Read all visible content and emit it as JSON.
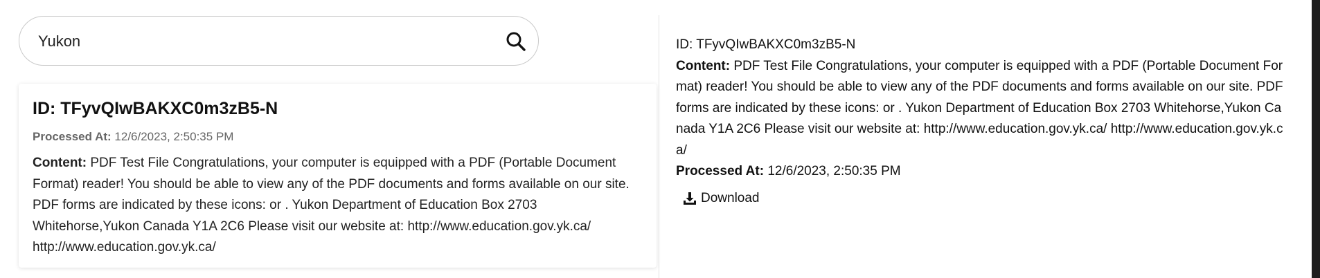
{
  "search": {
    "value": "Yukon"
  },
  "result": {
    "title": "ID: TFyvQIwBAKXC0m3zB5-N",
    "processed_label": "Processed At:",
    "processed_value": "12/6/2023, 2:50:35 PM",
    "content_label": "Content:",
    "content_text": "PDF Test File Congratulations, your computer is equipped with a PDF (Portable Document Format) reader! You should be able to view any of the PDF documents and forms available on our site. PDF forms are indicated by these icons: or . Yukon Department of Education Box 2703 Whitehorse,Yukon Canada Y1A 2C6 Please visit our website at: http://www.education.gov.yk.ca/ http://www.education.gov.yk.ca/"
  },
  "detail": {
    "id_line": "ID: TFyvQIwBAKXC0m3zB5-N",
    "content_label": "Content:",
    "content_text": "PDF Test File Congratulations, your computer is equipped with a PDF (Portable Document Format) reader! You should be able to view any of the PDF documents and forms available on our site. PDF forms are indicated by these icons: or . Yukon Department of Education Box 2703 Whitehorse,Yukon Canada Y1A 2C6 Please visit our website at: http://www.education.gov.yk.ca/ http://www.education.gov.yk.ca/",
    "processed_label": "Processed At:",
    "processed_value": "12/6/2023, 2:50:35 PM",
    "download_label": "Download",
    "download_icon": "download-icon"
  },
  "icons": {
    "search": "search-icon"
  }
}
